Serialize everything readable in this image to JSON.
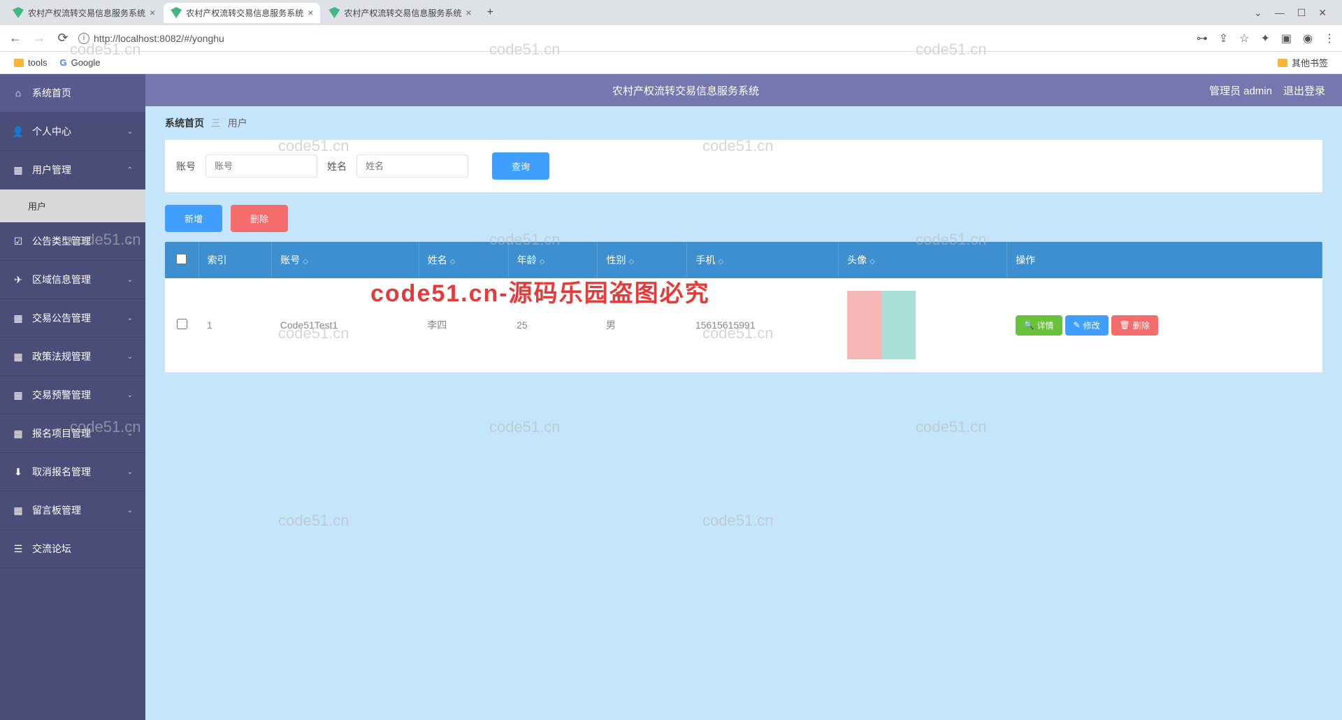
{
  "browser": {
    "tabs": [
      "农村产权流转交易信息服务系统",
      "农村产权流转交易信息服务系统",
      "农村产权流转交易信息服务系统"
    ],
    "url": "http://localhost:8082/#/yonghu",
    "bookmarks": {
      "tools": "tools",
      "google": "Google",
      "other": "其他书签"
    },
    "window": {
      "min": "—",
      "max": "☐",
      "close": "✕",
      "dropdown": "⌄"
    }
  },
  "topbar": {
    "title": "农村产权流转交易信息服务系统",
    "role": "管理员 admin",
    "logout": "退出登录"
  },
  "sidebar": {
    "home": "系统首页",
    "items": [
      {
        "icon": "person",
        "label": "个人中心",
        "expand": false
      },
      {
        "icon": "grid",
        "label": "用户管理",
        "expand": true,
        "sub": "用户"
      },
      {
        "icon": "doc",
        "label": "公告类型管理",
        "expand": false
      },
      {
        "icon": "plane",
        "label": "区域信息管理",
        "expand": false
      },
      {
        "icon": "grid",
        "label": "交易公告管理",
        "expand": false
      },
      {
        "icon": "grid",
        "label": "政策法规管理",
        "expand": false
      },
      {
        "icon": "grid",
        "label": "交易预警管理",
        "expand": false
      },
      {
        "icon": "grid",
        "label": "报名项目管理",
        "expand": false
      },
      {
        "icon": "down",
        "label": "取消报名管理",
        "expand": false
      },
      {
        "icon": "grid",
        "label": "留言板管理",
        "expand": false
      },
      {
        "icon": "chat",
        "label": "交流论坛",
        "expand": null
      }
    ]
  },
  "breadcrumb": {
    "home": "系统首页",
    "current": "用户"
  },
  "search": {
    "account_label": "账号",
    "account_ph": "账号",
    "name_label": "姓名",
    "name_ph": "姓名",
    "query_btn": "查询"
  },
  "actions": {
    "add": "新增",
    "del": "删除"
  },
  "table": {
    "headers": [
      "索引",
      "账号",
      "姓名",
      "年龄",
      "性别",
      "手机",
      "头像",
      "操作"
    ],
    "rows": [
      {
        "index": "1",
        "account": "Code51Test1",
        "name": "李四",
        "age": "25",
        "gender": "男",
        "phone": "15615615991"
      }
    ],
    "ops": {
      "detail": "详情",
      "edit": "修改",
      "delete": "删除"
    }
  },
  "watermarks": {
    "text": "code51.cn",
    "red": "code51.cn-源码乐园盗图必究"
  }
}
